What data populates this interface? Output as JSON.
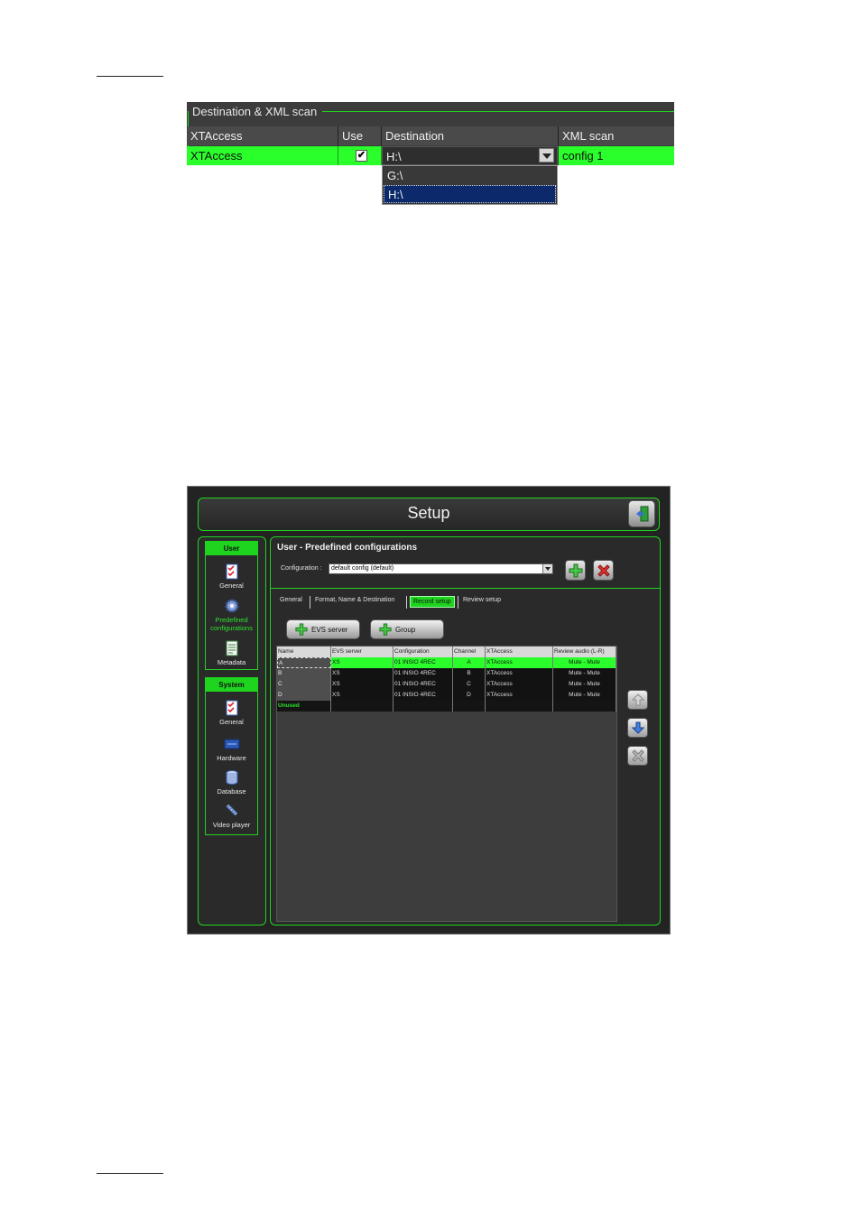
{
  "dest_panel": {
    "title": "Destination & XML scan",
    "headers": [
      "XTAccess",
      "Use",
      "Destination",
      "XML scan"
    ],
    "row": {
      "xtaccess": "XTAccess",
      "use_checked": "✔",
      "destination": "H:\\",
      "xml_scan": "config 1"
    },
    "dropdown_options": [
      "G:\\",
      "H:\\"
    ]
  },
  "setup": {
    "title": "Setup",
    "sidebar": {
      "user_group": "User",
      "user_items": [
        "General",
        "Predefined configurations",
        "Metadata"
      ],
      "system_group": "System",
      "system_items": [
        "General",
        "Hardware",
        "Database",
        "Video player"
      ]
    },
    "main_title": "User - Predefined configurations",
    "config_label": "Configuration :",
    "config_value": "default config (default)",
    "tabs": [
      "General",
      "Format, Name & Destination",
      "Record setup",
      "Review setup"
    ],
    "buttons": {
      "evs_server": "EVS server",
      "group": "Group"
    },
    "grid": {
      "columns": [
        "Name",
        "EVS server",
        "Configuration",
        "Channel",
        "XTAccess",
        "Review audio (L-R)"
      ],
      "rows": [
        [
          "A",
          "XS",
          "01 INSIO 4REC",
          "A",
          "XTAccess",
          "Mute - Mute"
        ],
        [
          "B",
          "XS",
          "01 INSIO 4REC",
          "B",
          "XTAccess",
          "Mute - Mute"
        ],
        [
          "C",
          "XS",
          "01 INSIO 4REC",
          "C",
          "XTAccess",
          "Mute - Mute"
        ],
        [
          "D",
          "XS",
          "01 INSIO 4REC",
          "D",
          "XTAccess",
          "Mute - Mute"
        ]
      ],
      "unused_label": "Unused"
    }
  },
  "colors": {
    "accent_green": "#1fd41f",
    "selection_green": "#2bff2b",
    "dropdown_highlight": "#0c2a6b"
  }
}
